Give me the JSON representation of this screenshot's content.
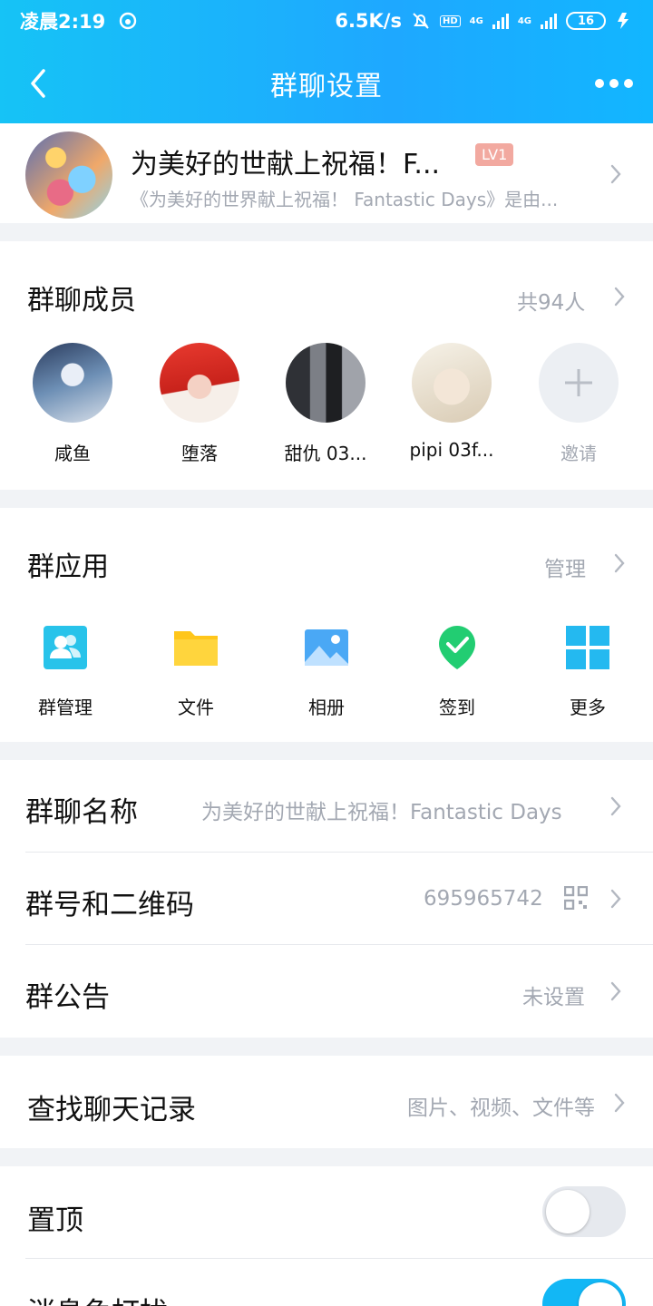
{
  "status_bar": {
    "time": "凌晨2:19",
    "speed": "6.5K/s",
    "hd": "HD",
    "net1": "4G",
    "net2": "4G",
    "battery": "16"
  },
  "header": {
    "title": "群聊设置"
  },
  "group": {
    "name": "为美好的世献上祝福！F...",
    "level": "LV1",
    "description": "《为美好的世界献上祝福！ Fantastic Days》是由..."
  },
  "members": {
    "title": "群聊成员",
    "count": "共94人",
    "list": [
      {
        "name": "咸鱼"
      },
      {
        "name": "堕落"
      },
      {
        "name": "甜仇 03..."
      },
      {
        "name": "pipi 03f..."
      }
    ],
    "invite_label": "邀请"
  },
  "apps": {
    "title": "群应用",
    "manage": "管理",
    "items": [
      {
        "label": "群管理",
        "icon": "group-manage-icon"
      },
      {
        "label": "文件",
        "icon": "folder-icon"
      },
      {
        "label": "相册",
        "icon": "album-icon"
      },
      {
        "label": "签到",
        "icon": "checkin-icon"
      },
      {
        "label": "更多",
        "icon": "grid-icon"
      }
    ]
  },
  "settings": {
    "group_name": {
      "label": "群聊名称",
      "value": "为美好的世献上祝福！Fantastic Days"
    },
    "group_id": {
      "label": "群号和二维码",
      "value": "695965742"
    },
    "announcement": {
      "label": "群公告",
      "value": "未设置"
    },
    "search_history": {
      "label": "查找聊天记录",
      "value": "图片、视频、文件等"
    },
    "pin_top": {
      "label": "置顶",
      "state": "off"
    },
    "mute": {
      "label": "消息免打扰",
      "state": "on"
    }
  },
  "colors": {
    "accent": "#12b7f5",
    "header_start": "#16c3f6",
    "level_badge": "#f2a9a0",
    "secondary_text": "#a3a8b2"
  }
}
